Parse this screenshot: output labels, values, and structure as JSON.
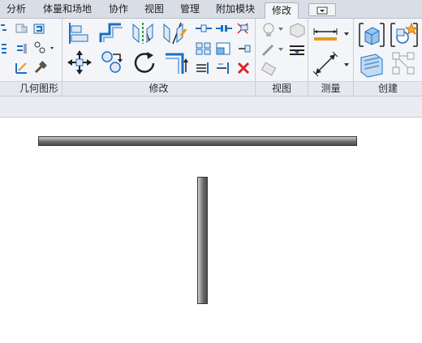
{
  "tabs": [
    {
      "label": "分析",
      "active": false
    },
    {
      "label": "体量和场地",
      "active": false
    },
    {
      "label": "协作",
      "active": false
    },
    {
      "label": "视图",
      "active": false
    },
    {
      "label": "管理",
      "active": false
    },
    {
      "label": "附加模块",
      "active": false
    },
    {
      "label": "修改",
      "active": true
    }
  ],
  "ribbon": {
    "panels": [
      {
        "label": "几何图形"
      },
      {
        "label": "修改"
      },
      {
        "label": "视图"
      },
      {
        "label": "测量"
      },
      {
        "label": "创建"
      }
    ]
  },
  "colors": {
    "tab_bar": "#d9dee6",
    "ribbon_bg": "#f3f5f8",
    "accent_blue": "#1b6fc2",
    "delete_red": "#d4262a",
    "wall_dark": "#4a4a4a"
  },
  "canvas": {
    "elements": [
      {
        "type": "wall",
        "orientation": "horizontal"
      },
      {
        "type": "wall",
        "orientation": "vertical"
      }
    ]
  }
}
